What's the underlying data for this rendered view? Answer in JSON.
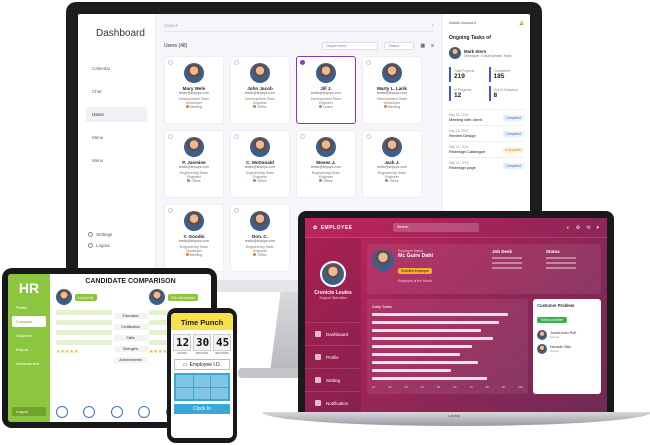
{
  "dashboard": {
    "title": "Dashboard",
    "nav": [
      "Calendar",
      "Chat",
      "Users",
      "Menu",
      "Menu"
    ],
    "bottom_nav": [
      "Settings",
      "Logout"
    ],
    "search_placeholder": "Search",
    "users_title": "Users (48)",
    "select1": "Department",
    "select2": "Status",
    "users": [
      {
        "name": "Mary Wels",
        "email": "testlx@khysys.com",
        "team": "Development Team",
        "role": "Developer",
        "status": "Meeting"
      },
      {
        "name": "John Jacob",
        "email": "testlx@khysys.com",
        "team": "Development Team",
        "role": "Engineer",
        "status": "Office"
      },
      {
        "name": "Jill J.",
        "email": "testlx@khysys.com",
        "team": "Development Team",
        "role": "Engineer",
        "status": "Leave"
      },
      {
        "name": "Marty L. Larik",
        "email": "testlx@khysys.com",
        "team": "Development Team",
        "role": "Developer",
        "status": "Meeting"
      },
      {
        "name": "P. Jasmine",
        "email": "testlx@khysys.com",
        "team": "Engineering Team",
        "role": "Engineer",
        "status": "Office"
      },
      {
        "name": "C. McDonald",
        "email": "testlx@khysys.com",
        "team": "Engineering Team",
        "role": "Engineer",
        "status": "Office"
      },
      {
        "name": "Moses J.",
        "email": "testlx@khysys.com",
        "team": "Engineering Team",
        "role": "Engineer",
        "status": "Office"
      },
      {
        "name": "Jack J.",
        "email": "testlx@khysys.com",
        "team": "Engineering Team",
        "role": "Engineer",
        "status": "Office"
      },
      {
        "name": "Y. Goodin",
        "email": "testlx@khysys.com",
        "team": "Engineering Team",
        "role": "Developer",
        "status": "Meeting"
      },
      {
        "name": "Don. C.",
        "email": "testlx@khysys.com",
        "team": "Engineering Team",
        "role": "Engineer",
        "status": "Office"
      }
    ],
    "right": {
      "account": "Admin Account",
      "ongoing_title": "Ongoing Tasks of",
      "assignee_name": "Mark Stern",
      "assignee_role": "Developer / Development Team",
      "stats": [
        {
          "label": "Total Projects",
          "value": "219"
        },
        {
          "label": "Completed",
          "value": "185"
        },
        {
          "label": "In Progress",
          "value": "12"
        },
        {
          "label": "Out of Schedule",
          "value": "8"
        }
      ],
      "tasks": [
        {
          "date": "May 18, 2019",
          "name": "Meeting with client",
          "status": "Completed"
        },
        {
          "date": "May 18, 2019",
          "name": "Review Design",
          "status": "Completed"
        },
        {
          "date": "May 18, 2019",
          "name": "Redesign Catalogue",
          "status": "In progress"
        },
        {
          "date": "May 18, 2019",
          "name": "Redesign page",
          "status": "Completed"
        }
      ]
    }
  },
  "employee": {
    "logo": "EMPLOYEE",
    "search": "Search",
    "header_icons": [
      "◐",
      "⚙",
      "⟲",
      "▾"
    ],
    "profile_name": "Cronicle Loules",
    "profile_role": "Support Specialist",
    "nav": [
      "Dashboard",
      "Profile",
      "Setting",
      "Notification"
    ],
    "employee_label": "Employee Name",
    "employee_name": "Mc Guire Dahl",
    "employee_pill": "Excellent Employee",
    "employee_sub": "Employee of the Month",
    "col1": "Job Desk",
    "col2": "Status",
    "chart_title": "Daily Sales",
    "axis": [
      "10",
      "20",
      "30",
      "40",
      "50",
      "60",
      "70",
      "80",
      "90",
      "100"
    ],
    "problem_title": "Customer Problem",
    "problem_badge": "Solved problem",
    "people": [
      {
        "name": "Jonah-scan Roff",
        "sub": "Solved"
      },
      {
        "name": "Nanade Ottis",
        "sub": "Solved"
      }
    ],
    "brand": "Laptop"
  },
  "hr": {
    "logo": "HR",
    "nav": [
      "Profile",
      "Compare",
      "Students",
      "Report",
      "Achievement"
    ],
    "logout": "Logout",
    "title": "CANDIDATE COMPARISON",
    "cand1": "Lionel M.",
    "cand2": "Chr.Anderson",
    "labels": [
      "Education",
      "Certification",
      "Skills",
      "Strengths",
      "Achievements"
    ],
    "stars": "★★★★★"
  },
  "timepunch": {
    "title": "Time Punch",
    "hours": "12",
    "minutes": "30",
    "seconds": "45",
    "units": [
      "HOURS",
      "MINUTES",
      "SECONDS"
    ],
    "employee_id": "Employee I.D.",
    "clock_in": "Clock In"
  }
}
